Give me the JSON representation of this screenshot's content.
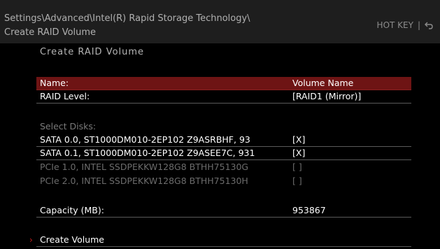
{
  "breadcrumb": {
    "line1": "Settings\\Advanced\\Intel(R) Rapid Storage Technology\\",
    "line2": "Create RAID Volume"
  },
  "hotkey": {
    "label": "HOT KEY",
    "separator": "|",
    "back_icon": "back-arrow-icon"
  },
  "panel_title": "Create  RAID  Volume",
  "fields": {
    "name": {
      "label": "Name:",
      "value": "Volume Name"
    },
    "raid_level": {
      "label": "RAID Level:",
      "value": "[RAID1 (Mirror)]"
    }
  },
  "select_disks_label": "Select Disks:",
  "disks": [
    {
      "label": "SATA 0.0, ST1000DM010-2EP102 Z9ASRBHF, 93",
      "value": "[X]",
      "enabled": true
    },
    {
      "label": "SATA 0.1, ST1000DM010-2EP102 Z9ASEE7C, 931",
      "value": "[X]",
      "enabled": true
    },
    {
      "label": "PCIe 1.0, INTEL SSDPEKKW128G8 BTHH75130G",
      "value": "[ ]",
      "enabled": false
    },
    {
      "label": "PCIe 2.0, INTEL SSDPEKKW128G8 BTHH75130H",
      "value": "[ ]",
      "enabled": false
    }
  ],
  "capacity": {
    "label": "Capacity (MB):",
    "value": "953867"
  },
  "create_volume": {
    "label": "Create Volume",
    "arrow": "›"
  },
  "colors": {
    "selected_row": "#6e1414",
    "accent_arrow": "#c81e1e",
    "header_bg": "#1e1e1e"
  }
}
